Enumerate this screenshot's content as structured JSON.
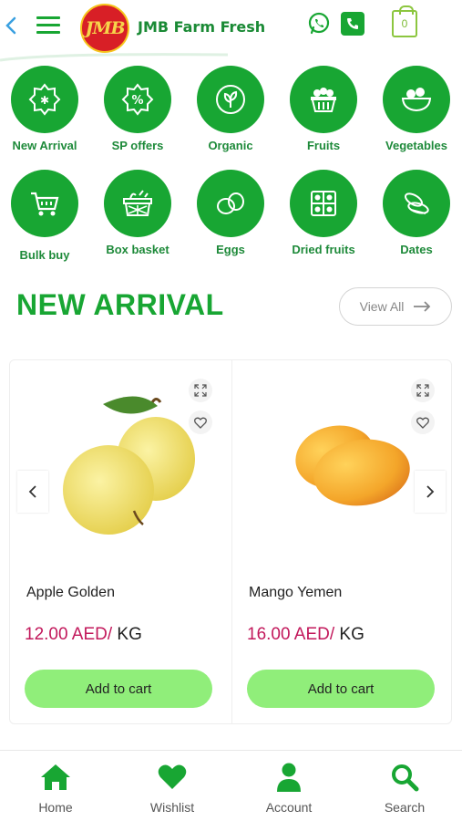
{
  "header": {
    "logo_text": "JMB",
    "logo_subtext": "Farm Fresh",
    "brand": "JMB Farm Fresh",
    "cart_count": "0",
    "colors": {
      "brand_green": "#18a633",
      "logo_red": "#d81f26",
      "logo_yellow": "#f6d54a"
    }
  },
  "categories": [
    {
      "label": "New Arrival",
      "icon": "badge-star-icon"
    },
    {
      "label": "SP offers",
      "icon": "percent-badge-icon"
    },
    {
      "label": "Organic",
      "icon": "leaf-icon"
    },
    {
      "label": "Fruits",
      "icon": "fruit-basket-icon"
    },
    {
      "label": "Vegetables",
      "icon": "vegetable-bowl-icon"
    },
    {
      "label": "Bulk buy",
      "icon": "shopping-cart-icon"
    },
    {
      "label": "Box basket",
      "icon": "box-basket-icon"
    },
    {
      "label": "Eggs",
      "icon": "eggs-icon"
    },
    {
      "label": "Dried fruits",
      "icon": "dried-fruits-box-icon"
    },
    {
      "label": "Dates",
      "icon": "dates-icon"
    }
  ],
  "section": {
    "title": "NEW ARRIVAL",
    "view_all": "View All"
  },
  "products": [
    {
      "name": "Apple Golden",
      "price": "12.00 AED/",
      "unit": "KG",
      "add_label": "Add to cart"
    },
    {
      "name": "Mango Yemen",
      "price": "16.00 AED/",
      "unit": "KG",
      "add_label": "Add to cart"
    }
  ],
  "bottom_nav": [
    {
      "label": "Home",
      "icon": "home-icon"
    },
    {
      "label": "Wishlist",
      "icon": "heart-icon"
    },
    {
      "label": "Account",
      "icon": "user-icon"
    },
    {
      "label": "Search",
      "icon": "search-icon"
    }
  ]
}
